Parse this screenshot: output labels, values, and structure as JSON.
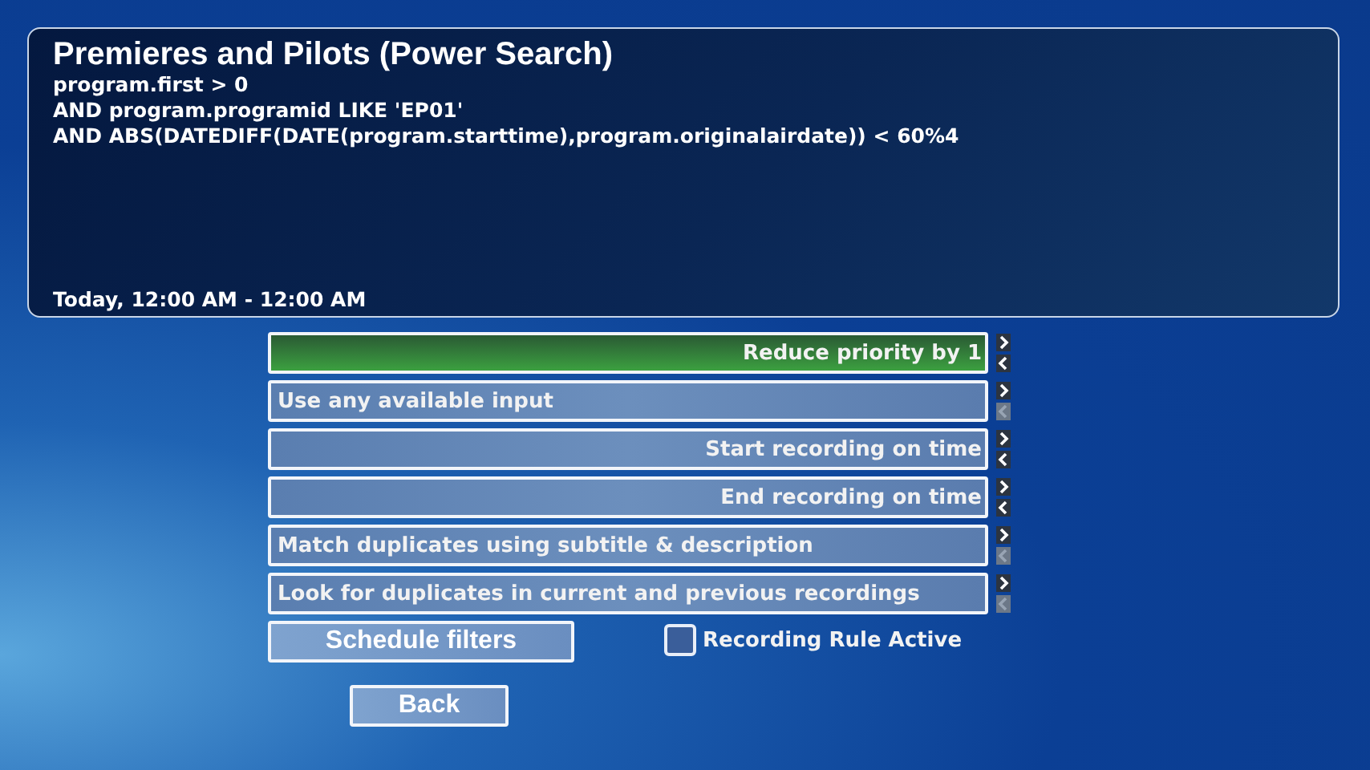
{
  "info_panel": {
    "title": "Premieres and Pilots (Power Search)",
    "query_lines": [
      "program.first > 0",
      "AND program.programid LIKE 'EP01'",
      "AND ABS(DATEDIFF(DATE(program.starttime),program.originalairdate)) < 60%4"
    ],
    "time_range": "Today, 12:00 AM - 12:00 AM"
  },
  "options": [
    {
      "label": "Reduce priority by 1",
      "selected": true,
      "right_aligned": true,
      "prev_enabled": true
    },
    {
      "label": "Use any available input",
      "selected": false,
      "right_aligned": false,
      "prev_enabled": false
    },
    {
      "label": "Start recording on time",
      "selected": false,
      "right_aligned": true,
      "prev_enabled": true
    },
    {
      "label": "End recording on time",
      "selected": false,
      "right_aligned": true,
      "prev_enabled": true
    },
    {
      "label": "Match duplicates using subtitle & description",
      "selected": false,
      "right_aligned": false,
      "prev_enabled": false
    },
    {
      "label": "Look for duplicates in current and previous recordings",
      "selected": false,
      "right_aligned": false,
      "prev_enabled": false
    }
  ],
  "schedule_filters_button": "Schedule filters",
  "recording_rule_active": {
    "label": "Recording Rule Active",
    "checked": false
  },
  "back_button": "Back"
}
